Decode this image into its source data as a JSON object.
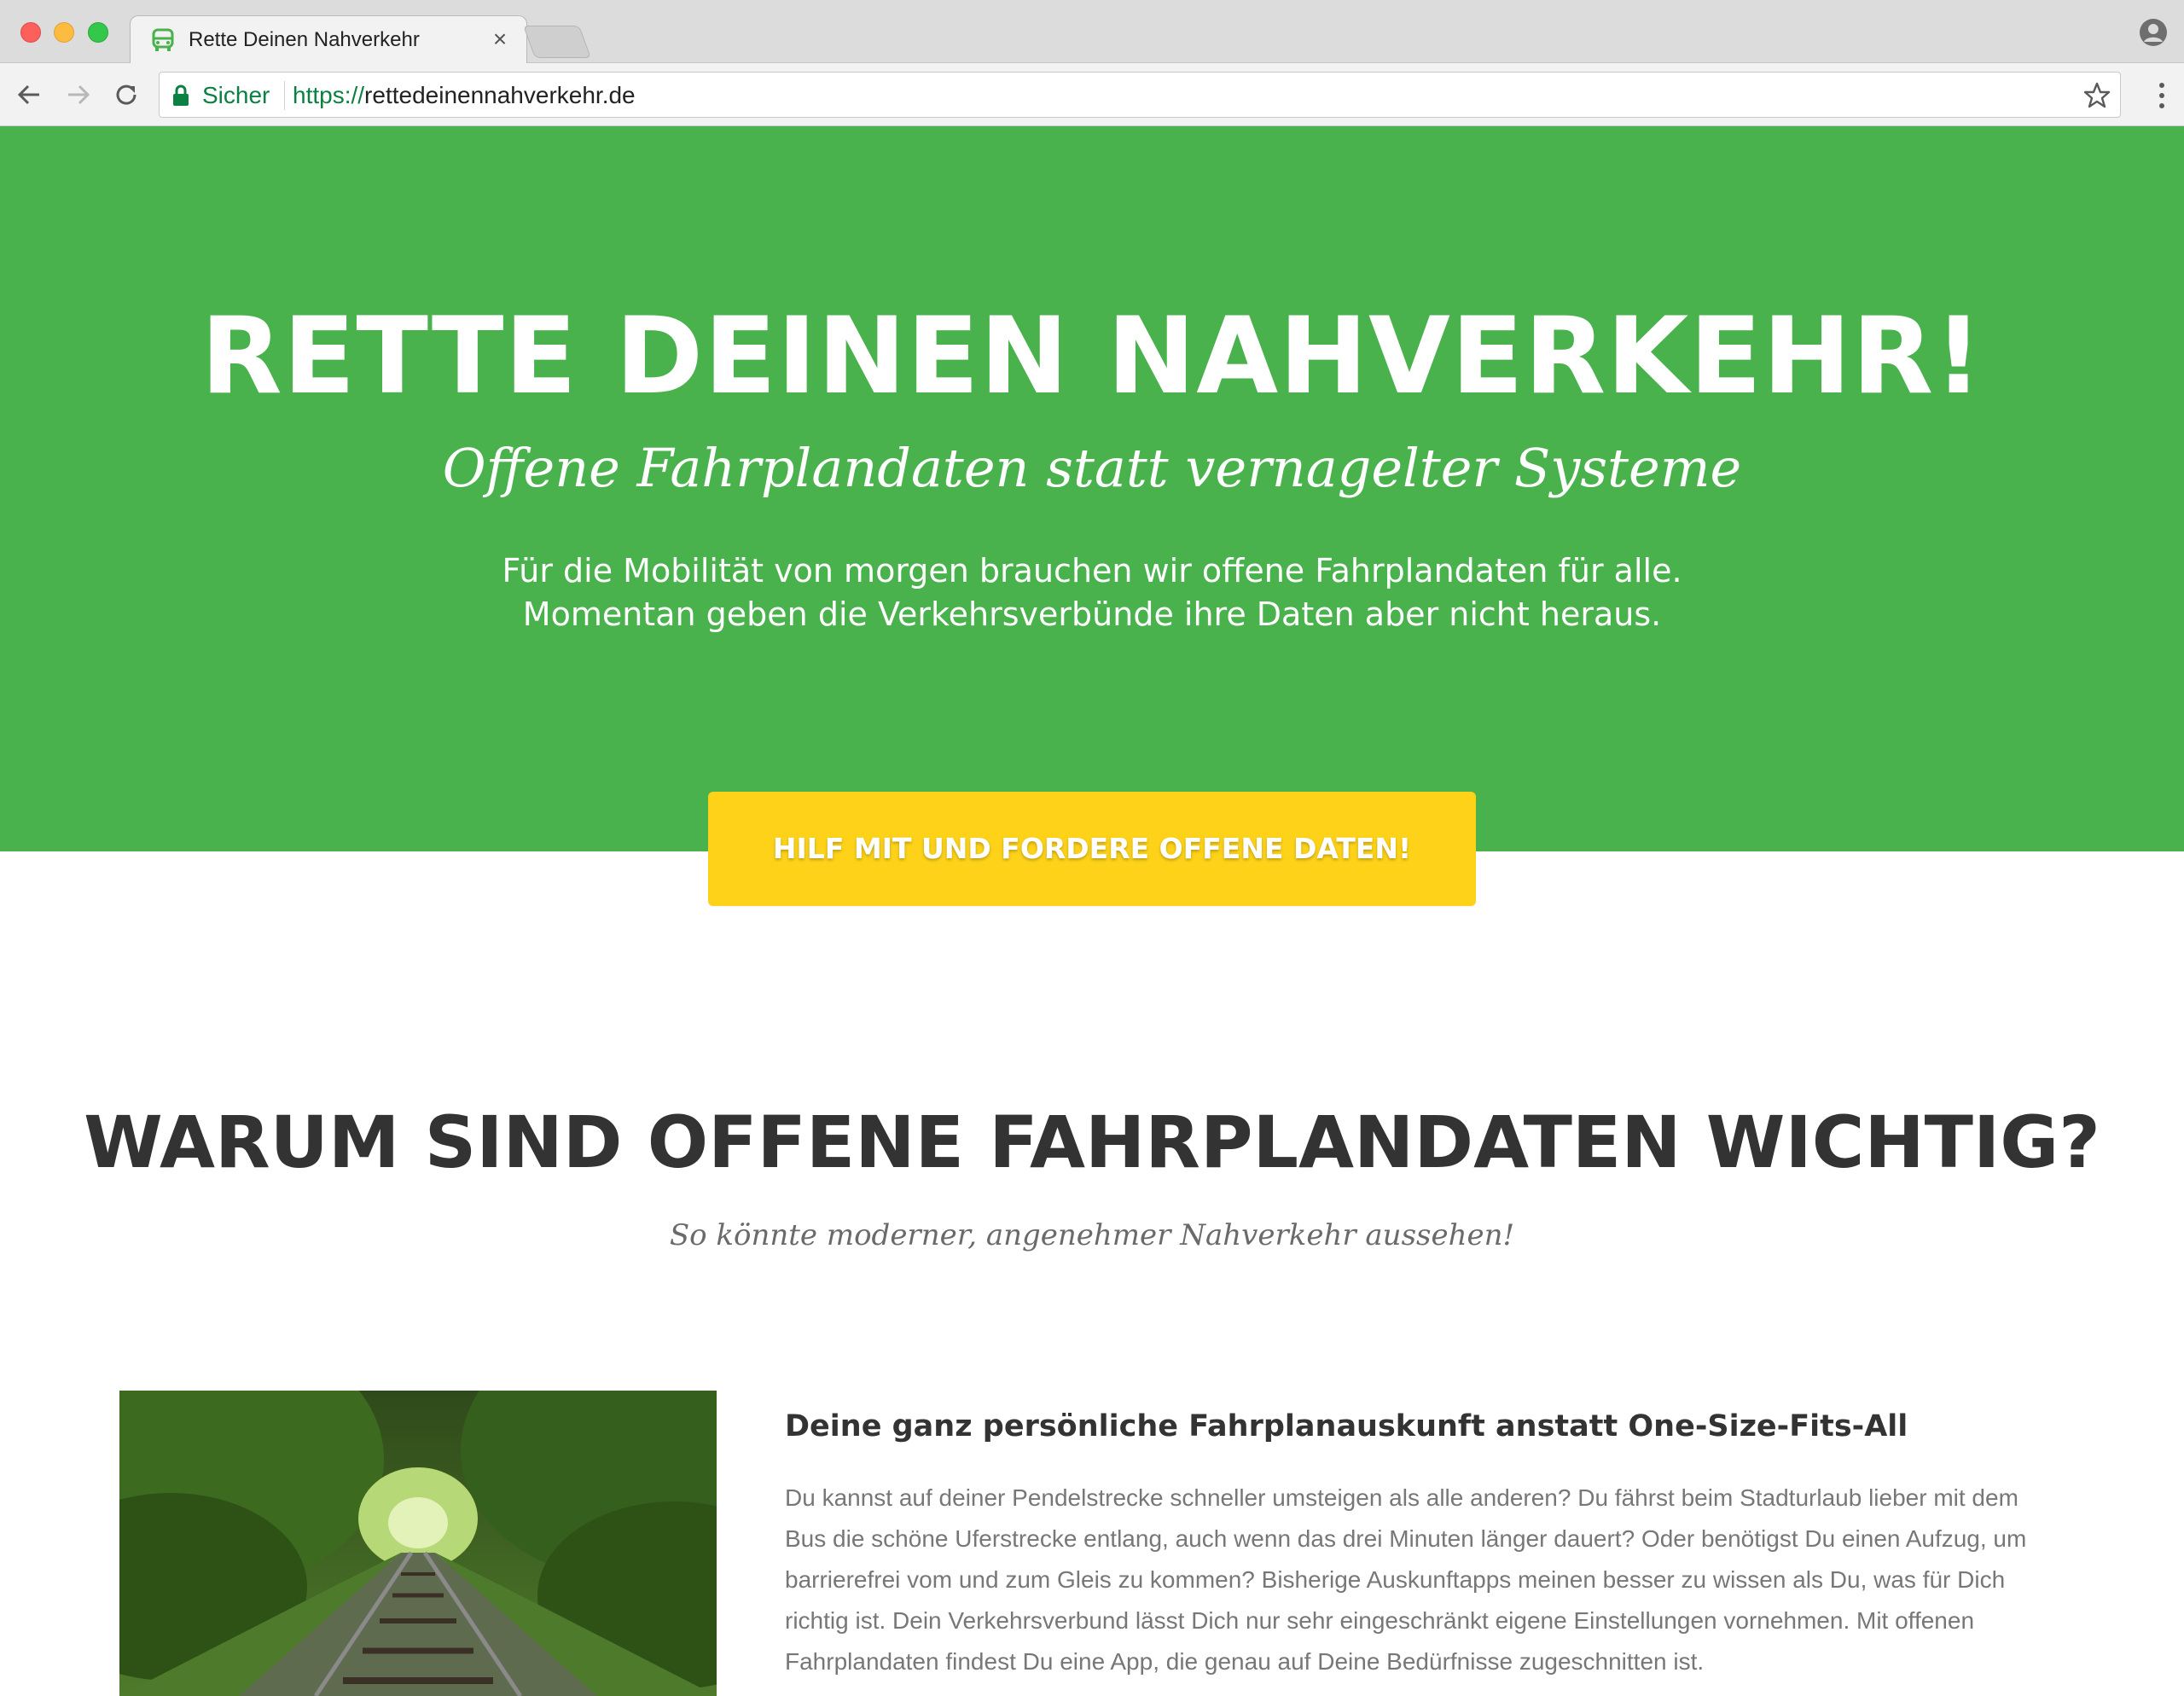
{
  "browser": {
    "tab_title": "Rette Deinen Nahverkehr",
    "tab_close": "×",
    "secure_label": "Sicher",
    "url_scheme": "https://",
    "url_host": "rettedeinennahverkehr.de",
    "icons": {
      "favicon": "bus-icon",
      "back": "arrow-left-icon",
      "forward": "arrow-right-icon",
      "reload": "reload-icon",
      "lock": "lock-icon",
      "bookmark": "star-icon",
      "menu": "kebab-menu-icon",
      "profile": "person-icon"
    }
  },
  "hero": {
    "title": "RETTE DEINEN NAHVERKEHR!",
    "subtitle": "Offene Fahrplandaten statt vernagelter Systeme",
    "text_line1": "Für die Mobilität von morgen brauchen wir offene Fahrplandaten für alle.",
    "text_line2": "Momentan geben die Verkehrsverbünde ihre Daten aber nicht heraus.",
    "cta_label": "HILF MIT UND FORDERE OFFENE DATEN!"
  },
  "section": {
    "title": "WARUM SIND OFFENE FAHRPLANDATEN WICHTIG?",
    "subtitle": "So könnte moderner, angenehmer Nahverkehr aussehen!"
  },
  "feature": {
    "title": "Deine ganz persönliche Fahrplanauskunft anstatt One-Size-Fits-All",
    "text": "Du kannst auf deiner Pendelstrecke schneller umsteigen als alle anderen? Du fährst beim Stadturlaub lieber mit dem Bus die schöne Uferstrecke entlang, auch wenn das drei Minuten länger dauert? Oder benötigst Du einen Aufzug, um barrierefrei vom und zum Gleis zu kommen? Bisherige Auskunftapps meinen besser zu wissen als Du, was für Dich richtig ist. Dein Verkehrsverbund lässt Dich nur sehr eingeschränkt eigene Einstellungen vornehmen. Mit offenen Fahrplandaten findest Du eine App, die genau auf Deine Bedürfnisse zugeschnitten ist."
  },
  "colors": {
    "hero_green": "#49b24d",
    "cta_yellow": "#fdd219",
    "heading_dark": "#333333",
    "body_gray": "#777777",
    "secure_green": "#0b8043"
  }
}
